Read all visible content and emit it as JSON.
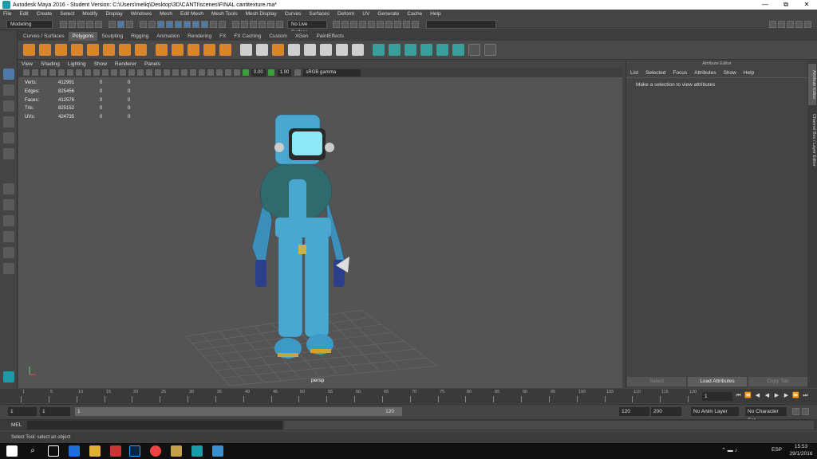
{
  "window": {
    "title": "Autodesk Maya 2016 - Student Version: C:\\Users\\meliq\\Desktop\\3D\\CANTI\\scenes\\FINAL cantitexture.ma*",
    "controls": [
      "—",
      "⧉",
      "✕"
    ]
  },
  "menubar": [
    "File",
    "Edit",
    "Create",
    "Select",
    "Modify",
    "Display",
    "Windows",
    "Mesh",
    "Edit Mesh",
    "Mesh Tools",
    "Mesh Display",
    "Curves",
    "Surfaces",
    "Deform",
    "UV",
    "Generate",
    "Cache",
    "Help"
  ],
  "statusline": {
    "mode": "Modeling",
    "live_surface": "No Live Surface"
  },
  "shelf_tabs": [
    "Curves / Surfaces",
    "Polygons",
    "Sculpting",
    "Rigging",
    "Animation",
    "Rendering",
    "FX",
    "FX Caching",
    "Custom",
    "XGen",
    "PaintEffects"
  ],
  "active_shelf_tab": "Polygons",
  "viewport_menu": [
    "View",
    "Shading",
    "Lighting",
    "Show",
    "Renderer",
    "Panels"
  ],
  "viewport_toolbar": {
    "value1": "0.00",
    "value2": "1.00",
    "colorspace": "sRGB gamma"
  },
  "hud": [
    {
      "label": "Verts:",
      "value": "412991",
      "c2": "0",
      "c3": "0"
    },
    {
      "label": "Edges:",
      "value": "825456",
      "c2": "0",
      "c3": "0"
    },
    {
      "label": "Faces:",
      "value": "412576",
      "c2": "0",
      "c3": "0"
    },
    {
      "label": "Tris:",
      "value": "825152",
      "c2": "0",
      "c3": "0"
    },
    {
      "label": "UVs:",
      "value": "424735",
      "c2": "0",
      "c3": "0"
    }
  ],
  "camera_label": "persp",
  "attribute_editor": {
    "title": "Attribute Editor",
    "menu": [
      "List",
      "Selected",
      "Focus",
      "Attributes",
      "Show",
      "Help"
    ],
    "message": "Make a selection to view attributes",
    "buttons": [
      "Select",
      "Load Attributes",
      "Copy Tab"
    ]
  },
  "side_tabs": [
    "Attribute Editor",
    "Channel Box / Layer Editor"
  ],
  "timeline": {
    "ticks": [
      "1",
      "5",
      "10",
      "15",
      "20",
      "25",
      "30",
      "35",
      "40",
      "45",
      "50",
      "55",
      "60",
      "65",
      "70",
      "75",
      "80",
      "85",
      "90",
      "95",
      "100",
      "105",
      "110",
      "115",
      "120"
    ],
    "current_frame": "1"
  },
  "range": {
    "start": "1",
    "playback_start": "1",
    "slider_start": "1",
    "slider_end": "120",
    "playback_end": "120",
    "end": "200",
    "anim_layer": "No Anim Layer",
    "character_set": "No Character Set"
  },
  "command_line": {
    "label": "MEL"
  },
  "help_line": "Select Tool: select an object",
  "taskbar": {
    "time": "15:53",
    "date": "29/1/2016",
    "lang": "ESP"
  }
}
